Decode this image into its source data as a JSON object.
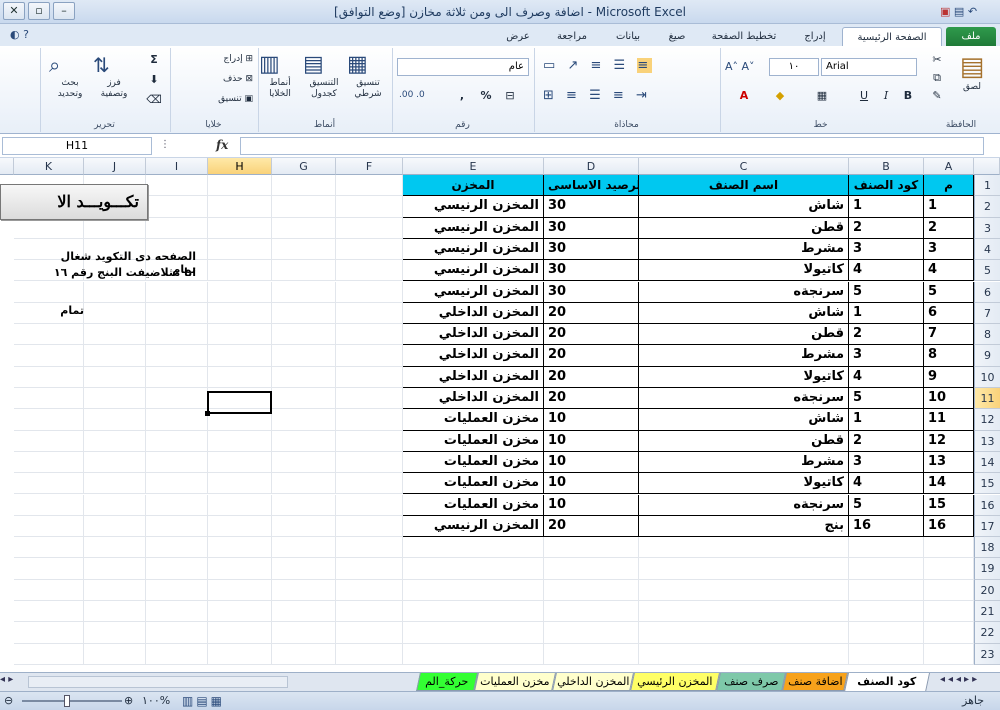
{
  "window": {
    "title": "اضافة وصرف الى ومن ثلاثة مخازن  [وضع التوافق] - Microsoft Excel",
    "minimize": "–",
    "maximize": "▫",
    "close": "✕"
  },
  "ribbon_tabs": [
    "ملف",
    "الصفحة الرئيسية",
    "إدراج",
    "تخطيط الصفحة",
    "صيغ",
    "بيانات",
    "مراجعة",
    "عرض"
  ],
  "ribbon": {
    "clipboard": {
      "group": "الحافظة",
      "paste": "لصق"
    },
    "font": {
      "group": "خط",
      "font_name": "Arial",
      "font_size": "١٠",
      "bold": "B",
      "italic": "I",
      "underline": "U"
    },
    "alignment": {
      "group": "محاذاة"
    },
    "number": {
      "group": "رقم",
      "format": "عام",
      "percent": "%",
      "comma": ","
    },
    "styles": {
      "group": "أنماط",
      "conditional": "تنسيق شرطي",
      "as_table": "التنسيق كجدول",
      "cell_styles": "أنماط الخلايا"
    },
    "cells": {
      "group": "خلايا",
      "insert": "إدراج",
      "delete": "حذف",
      "format": "تنسيق"
    },
    "editing": {
      "group": "تحرير",
      "sort": "فرز وتصفية",
      "find": "بحث وتحديد",
      "sum": "Σ"
    }
  },
  "formula_bar": {
    "name_box": "H11",
    "fx": "fx",
    "formula": ""
  },
  "columns": [
    "A",
    "B",
    "C",
    "D",
    "E",
    "F",
    "G",
    "H",
    "I",
    "J",
    "K"
  ],
  "selected_column": "H",
  "selected_row": 11,
  "rows": [
    "1",
    "2",
    "3",
    "4",
    "5",
    "6",
    "7",
    "8",
    "9",
    "10",
    "11",
    "12",
    "13",
    "14",
    "15",
    "16",
    "17",
    "18",
    "19",
    "20",
    "21",
    "22",
    "23"
  ],
  "table": {
    "headers": [
      "م",
      "كود الصنف",
      "اسم الصنف",
      "الرصيد الاساسى",
      "المخزن"
    ],
    "rows": [
      [
        "1",
        "1",
        "شاش",
        "30",
        "المخزن الرنيسي"
      ],
      [
        "2",
        "2",
        "قطن",
        "30",
        "المخزن الرنيسي"
      ],
      [
        "3",
        "3",
        "مشرط",
        "30",
        "المخزن الرنيسي"
      ],
      [
        "4",
        "4",
        "كاتيولا",
        "30",
        "المخزن الرنيسي"
      ],
      [
        "5",
        "5",
        "سرنجةه",
        "30",
        "المخزن الرنيسي"
      ],
      [
        "6",
        "1",
        "شاش",
        "20",
        "المخزن الداخلي"
      ],
      [
        "7",
        "2",
        "قطن",
        "20",
        "المخزن الداخلي"
      ],
      [
        "8",
        "3",
        "مشرط",
        "20",
        "المخزن الداخلي"
      ],
      [
        "9",
        "4",
        "كاتيولا",
        "20",
        "المخزن الداخلي"
      ],
      [
        "10",
        "5",
        "سرنجةه",
        "20",
        "المخزن الداخلي"
      ],
      [
        "11",
        "1",
        "شاش",
        "10",
        "مخزن العمليات"
      ],
      [
        "12",
        "2",
        "قطن",
        "10",
        "مخزن العمليات"
      ],
      [
        "13",
        "3",
        "مشرط",
        "10",
        "مخزن العمليات"
      ],
      [
        "14",
        "4",
        "كاتيولا",
        "10",
        "مخزن العمليات"
      ],
      [
        "15",
        "5",
        "سرنجةه",
        "10",
        "مخزن العمليات"
      ],
      [
        "16",
        "16",
        "بنج",
        "20",
        "المخزن الرنيسي"
      ]
    ]
  },
  "button": {
    "label": "تكـــويـــد الا"
  },
  "notes": {
    "line1": "الصفحه دى التكويد شغال تمام",
    "line2": "انا مثلاضيفت البنج رقم ١٦",
    "line3": "تمام"
  },
  "sheet_tabs": [
    "كود الصنف",
    "اضافة صنف",
    "صرف صنف",
    "المخزن الرئيسي",
    "المخزن الداخلي",
    "مخزن العمليات",
    "حركة_الم"
  ],
  "sheet_tab_colors": [
    "#ffffff",
    "#f7a21b",
    "#7ec8a9",
    "#ffff66",
    "#ffffcc",
    "#ffffcc",
    "#33ff33"
  ],
  "status": {
    "ready": "جاهز",
    "zoom": "%١٠٠"
  }
}
